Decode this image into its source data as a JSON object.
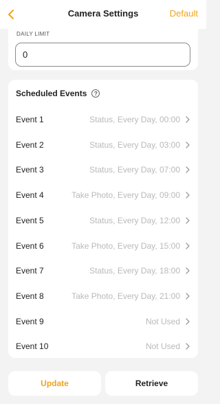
{
  "header": {
    "title": "Camera Settings",
    "action_label": "Default"
  },
  "daily_limit": {
    "label": "DAILY LIMIT",
    "value": "0"
  },
  "events": {
    "title": "Scheduled Events",
    "items": [
      {
        "name": "Event 1",
        "value": "Status, Every Day, 00:00"
      },
      {
        "name": "Event 2",
        "value": "Status, Every Day, 03:00"
      },
      {
        "name": "Event 3",
        "value": "Status, Every Day, 07:00"
      },
      {
        "name": "Event 4",
        "value": "Take Photo, Every Day, 09:00"
      },
      {
        "name": "Event 5",
        "value": "Status, Every Day, 12:00"
      },
      {
        "name": "Event 6",
        "value": "Take Photo, Every Day, 15:00"
      },
      {
        "name": "Event 7",
        "value": "Status, Every Day, 18:00"
      },
      {
        "name": "Event 8",
        "value": "Take Photo, Every Day, 21:00"
      },
      {
        "name": "Event 9",
        "value": "Not Used"
      },
      {
        "name": "Event 10",
        "value": "Not Used"
      }
    ]
  },
  "footer": {
    "update_label": "Update",
    "retrieve_label": "Retrieve"
  },
  "colors": {
    "accent": "#f0a31c",
    "muted_text": "#b9b9b9",
    "background": "#f3f3f3"
  }
}
